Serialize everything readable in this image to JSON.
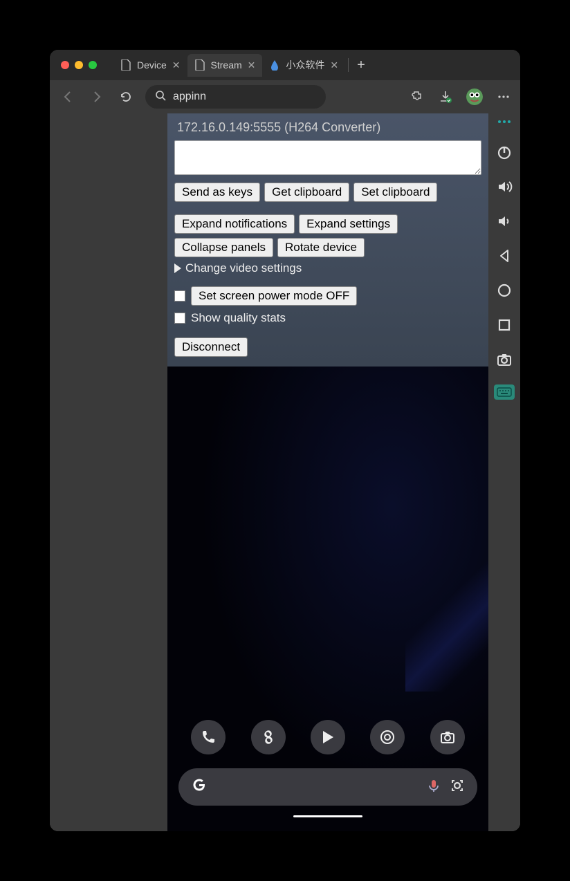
{
  "tabs": [
    {
      "label": "Device",
      "icon": "page"
    },
    {
      "label": "Stream",
      "icon": "page",
      "active": true
    },
    {
      "label": "小众软件",
      "icon": "drop"
    }
  ],
  "toolbar": {
    "search_value": "appinn"
  },
  "panel": {
    "title": "172.16.0.149:5555 (H264 Converter)",
    "buttons_row1": [
      "Send as keys",
      "Get clipboard",
      "Set clipboard"
    ],
    "buttons_row2": [
      "Expand notifications",
      "Expand settings"
    ],
    "buttons_row3": [
      "Collapse panels",
      "Rotate device"
    ],
    "expand_label": "Change video settings",
    "power_mode_label": "Set screen power mode OFF",
    "quality_stats_label": "Show quality stats",
    "disconnect_label": "Disconnect"
  },
  "phone": {
    "dock": [
      "phone",
      "fan",
      "play",
      "chrome",
      "camera"
    ],
    "search_letter": "G"
  },
  "side_toolbar": [
    "power",
    "volume-up",
    "volume-down",
    "back",
    "home",
    "overview",
    "screenshot",
    "keyboard"
  ]
}
